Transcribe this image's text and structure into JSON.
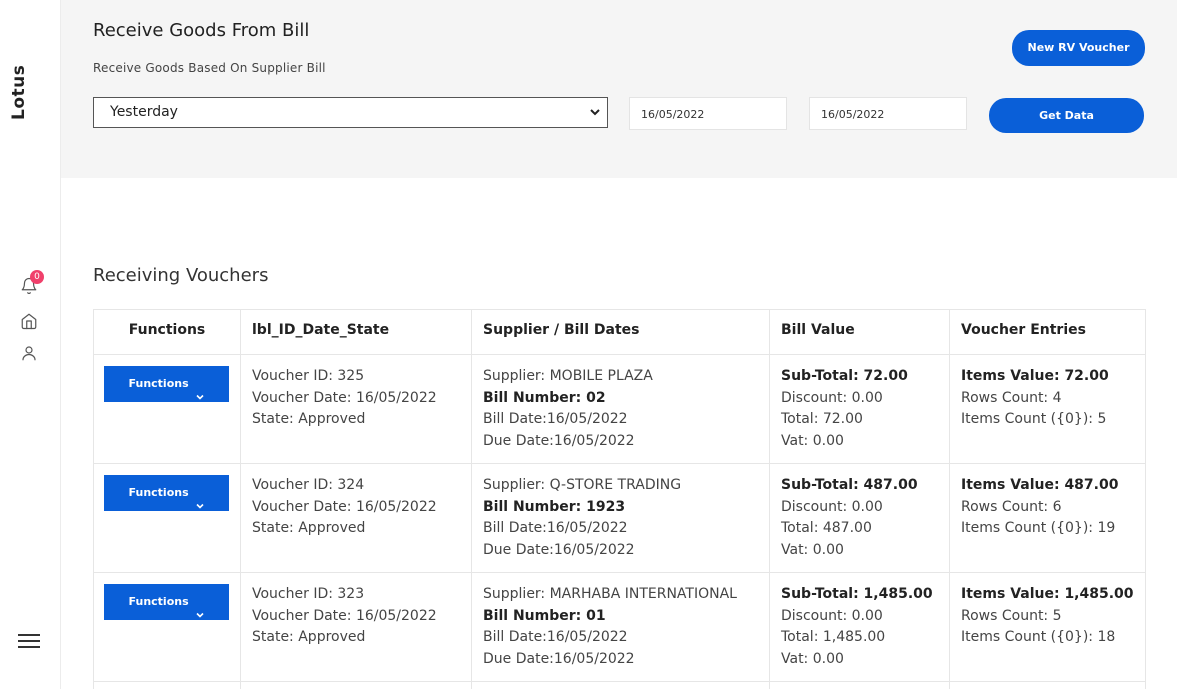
{
  "sidebar": {
    "brand": "Lotus",
    "notification_count": "0",
    "icons": [
      "bell-icon",
      "home-icon",
      "user-icon",
      "menu-icon"
    ]
  },
  "header": {
    "title": "Receive Goods From Bill",
    "subtitle": "Receive Goods Based On Supplier Bill",
    "range_selected": "Yesterday",
    "date_from": "16/05/2022",
    "date_to": "16/05/2022",
    "new_voucher_label": "New RV Voucher",
    "get_data_label": "Get Data"
  },
  "section": {
    "title": "Receiving Vouchers"
  },
  "table": {
    "columns": [
      "Functions",
      "lbl_ID_Date_State",
      "Supplier / Bill Dates",
      "Bill Value",
      "Voucher Entries"
    ],
    "rows": [
      {
        "functions_label": "Functions",
        "voucher_id": "Voucher ID: 325",
        "voucher_date": "Voucher Date: 16/05/2022",
        "state": "State: Approved",
        "supplier": "Supplier: MOBILE PLAZA",
        "bill_number": "Bill Number: 02",
        "bill_date": "Bill Date:16/05/2022",
        "due_date": "Due Date:16/05/2022",
        "sub_total": "Sub-Total: 72.00",
        "discount": "Discount: 0.00",
        "total": "Total: 72.00",
        "vat": "Vat: 0.00",
        "items_value": "Items Value: 72.00",
        "rows_count": "Rows Count: 4",
        "items_count": "Items Count ({0}): 5"
      },
      {
        "functions_label": "Functions",
        "voucher_id": "Voucher ID: 324",
        "voucher_date": "Voucher Date: 16/05/2022",
        "state": "State: Approved",
        "supplier": "Supplier: Q-STORE TRADING",
        "bill_number": "Bill Number: 1923",
        "bill_date": "Bill Date:16/05/2022",
        "due_date": "Due Date:16/05/2022",
        "sub_total": "Sub-Total: 487.00",
        "discount": "Discount: 0.00",
        "total": "Total: 487.00",
        "vat": "Vat: 0.00",
        "items_value": "Items Value: 487.00",
        "rows_count": "Rows Count: 6",
        "items_count": "Items Count ({0}): 19"
      },
      {
        "functions_label": "Functions",
        "voucher_id": "Voucher ID: 323",
        "voucher_date": "Voucher Date: 16/05/2022",
        "state": "State: Approved",
        "supplier": "Supplier: MARHABA INTERNATIONAL",
        "bill_number": "Bill Number: 01",
        "bill_date": "Bill Date:16/05/2022",
        "due_date": "Due Date:16/05/2022",
        "sub_total": "Sub-Total: 1,485.00",
        "discount": "Discount: 0.00",
        "total": "Total: 1,485.00",
        "vat": "Vat: 0.00",
        "items_value": "Items Value: 1,485.00",
        "rows_count": "Rows Count: 5",
        "items_count": "Items Count ({0}): 18"
      }
    ]
  },
  "colors": {
    "primary": "#0a5fd8",
    "badge": "#f0406b",
    "header_bg": "#f5f5f5"
  }
}
